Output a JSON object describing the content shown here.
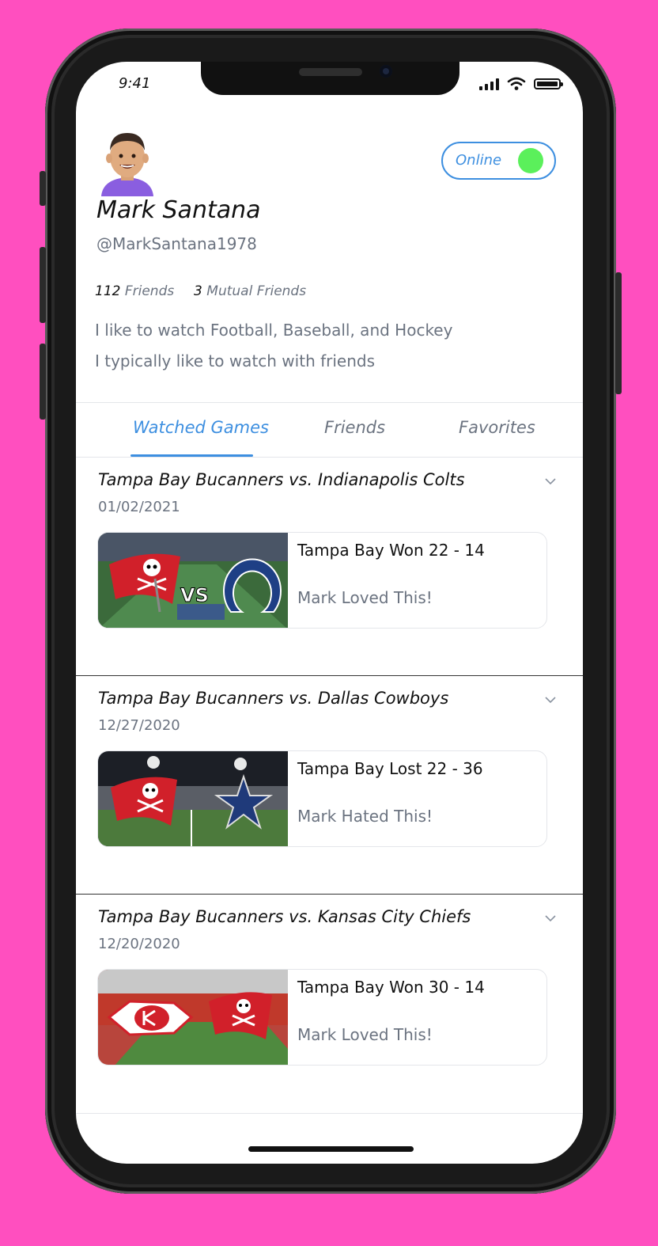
{
  "status_bar": {
    "time": "9:41"
  },
  "profile": {
    "name": "Mark Santana",
    "handle": "@MarkSantana1978",
    "friends_count": "112",
    "friends_label": "Friends",
    "mutual_count": "3",
    "mutual_label": "Mutual Friends",
    "bio_lines": [
      "I like to watch Football, Baseball, and Hockey",
      "I typically like to watch with friends"
    ],
    "status_label": "Online"
  },
  "tabs": [
    {
      "label": "Watched Games",
      "active": true
    },
    {
      "label": "Friends",
      "active": false
    },
    {
      "label": "Favorites",
      "active": false
    }
  ],
  "games": [
    {
      "title": "Tampa Bay Bucanners vs. Indianapolis Colts",
      "date": "01/02/2021",
      "result": "Tampa Bay Won 22 - 14",
      "reaction": "Mark Loved This!",
      "thumb_text": "VS"
    },
    {
      "title": "Tampa Bay Bucanners vs. Dallas Cowboys",
      "date": "12/27/2020",
      "result": "Tampa Bay Lost 22 - 36",
      "reaction": "Mark Hated This!"
    },
    {
      "title": "Tampa Bay Bucanners vs. Kansas City Chiefs",
      "date": "12/20/2020",
      "result": "Tampa Bay Won 30 - 14",
      "reaction": "Mark Loved This!"
    }
  ],
  "colors": {
    "background": "#ff4fbf",
    "accent": "#3d8fe0",
    "online": "#5bf05b"
  }
}
